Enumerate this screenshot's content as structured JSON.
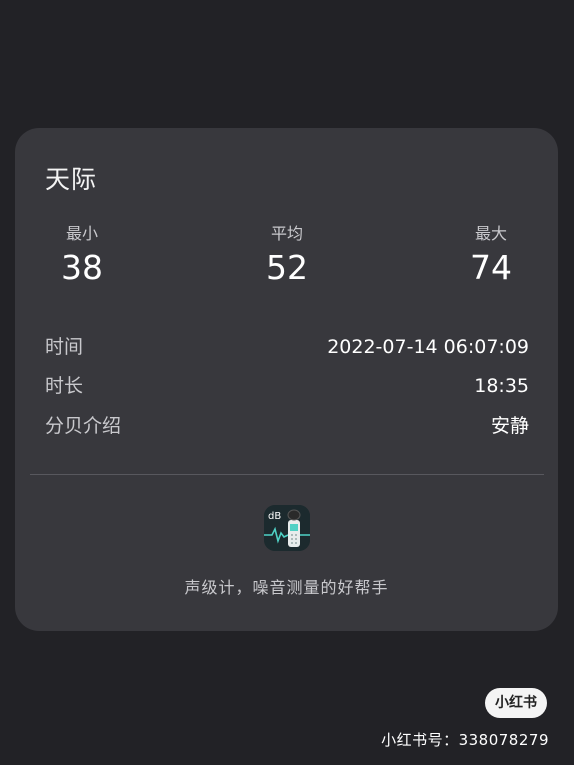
{
  "card": {
    "title": "天际",
    "stats": {
      "min": {
        "label": "最小",
        "value": "38"
      },
      "avg": {
        "label": "平均",
        "value": "52"
      },
      "max": {
        "label": "最大",
        "value": "74"
      }
    },
    "info": {
      "time": {
        "label": "时间",
        "value": "2022-07-14 06:07:09"
      },
      "duration": {
        "label": "时长",
        "value": "18:35"
      },
      "description": {
        "label": "分贝介绍",
        "value": "安静"
      }
    },
    "app": {
      "icon": "decibel-meter-app-icon",
      "icon_text": "dB",
      "tagline": "声级计，噪音测量的好帮手"
    }
  },
  "watermark": {
    "badge": "小红书",
    "id_text": "小红书号：338078279"
  },
  "colors": {
    "background": "#222226",
    "card": "#38383d",
    "text_primary": "#ffffff",
    "text_secondary": "#c9c9cd",
    "icon_accent": "#4fd1c5"
  }
}
